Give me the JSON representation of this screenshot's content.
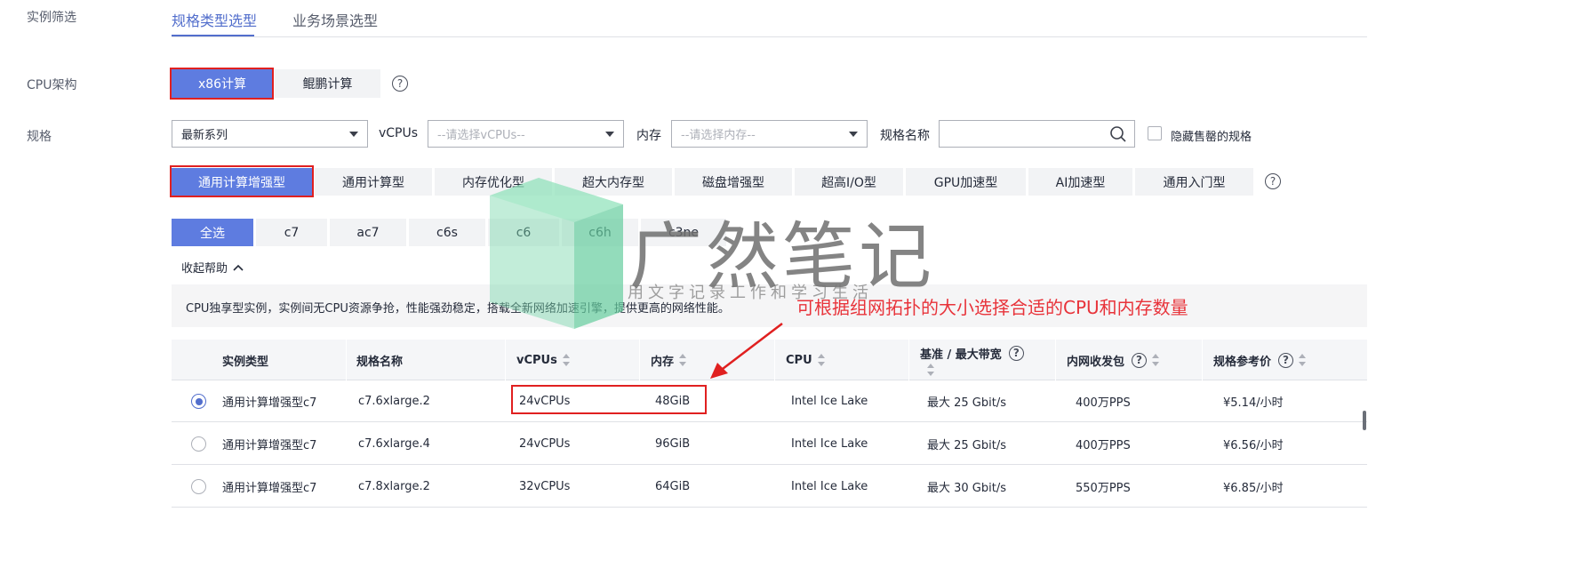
{
  "filter": {
    "label": "实例筛选",
    "tabs": [
      {
        "label": "规格类型选型",
        "active": true
      },
      {
        "label": "业务场景选型",
        "active": false
      }
    ]
  },
  "cpu_arch": {
    "label": "CPU架构",
    "options": [
      {
        "label": "x86计算",
        "selected": true
      },
      {
        "label": "鲲鹏计算",
        "selected": false
      }
    ],
    "help_icon": "question-circle-icon"
  },
  "spec": {
    "label": "规格",
    "series_select": {
      "value": "最新系列"
    },
    "vcpus": {
      "label": "vCPUs",
      "placeholder": "--请选择vCPUs--"
    },
    "memory": {
      "label": "内存",
      "placeholder": "--请选择内存--"
    },
    "spec_name": {
      "label": "规格名称",
      "value": ""
    },
    "hide_soldout": {
      "label": "隐藏售罄的规格",
      "checked": false
    }
  },
  "type_buttons": [
    {
      "label": "通用计算增强型",
      "selected": true
    },
    {
      "label": "通用计算型",
      "selected": false
    },
    {
      "label": "内存优化型",
      "selected": false
    },
    {
      "label": "超大内存型",
      "selected": false
    },
    {
      "label": "磁盘增强型",
      "selected": false
    },
    {
      "label": "超高I/O型",
      "selected": false
    },
    {
      "label": "GPU加速型",
      "selected": false
    },
    {
      "label": "AI加速型",
      "selected": false
    },
    {
      "label": "通用入门型",
      "selected": false
    }
  ],
  "family_buttons": [
    {
      "label": "全选",
      "selected": true
    },
    {
      "label": "c7",
      "selected": false
    },
    {
      "label": "ac7",
      "selected": false
    },
    {
      "label": "c6s",
      "selected": false
    },
    {
      "label": "c6",
      "selected": false
    },
    {
      "label": "c6h",
      "selected": false
    },
    {
      "label": "c3ne",
      "selected": false
    }
  ],
  "help_toggle": "收起帮助",
  "banner_text": "CPU独享型实例，实例间无CPU资源争抢，性能强劲稳定，搭载全新网络加速引擎，提供更高的网络性能。",
  "annotation": "可根据组网拓扑的大小选择合适的CPU和内存数量",
  "table": {
    "headers": [
      "实例类型",
      "规格名称",
      "vCPUs",
      "内存",
      "CPU",
      "基准 / 最大带宽",
      "内网收发包",
      "规格参考价"
    ],
    "rows": [
      {
        "selected": true,
        "type": "通用计算增强型c7",
        "name": "c7.6xlarge.2",
        "vcpus": "24vCPUs",
        "mem": "48GiB",
        "cpu": "Intel Ice Lake",
        "bw": "最大 25 Gbit/s",
        "pps": "400万PPS",
        "price": "¥5.14/小时"
      },
      {
        "selected": false,
        "type": "通用计算增强型c7",
        "name": "c7.6xlarge.4",
        "vcpus": "24vCPUs",
        "mem": "96GiB",
        "cpu": "Intel Ice Lake",
        "bw": "最大 25 Gbit/s",
        "pps": "400万PPS",
        "price": "¥6.56/小时"
      },
      {
        "selected": false,
        "type": "通用计算增强型c7",
        "name": "c7.8xlarge.2",
        "vcpus": "32vCPUs",
        "mem": "64GiB",
        "cpu": "Intel Ice Lake",
        "bw": "最大 30 Gbit/s",
        "pps": "550万PPS",
        "price": "¥6.85/小时"
      }
    ]
  },
  "watermark": {
    "title": "广然笔记",
    "subtitle": "用文字记录工作和学习生活"
  },
  "colors": {
    "primary": "#5e7ce0",
    "accent_text": "#526ecc",
    "highlight": "#e02020",
    "annotation": "#e8333a"
  }
}
